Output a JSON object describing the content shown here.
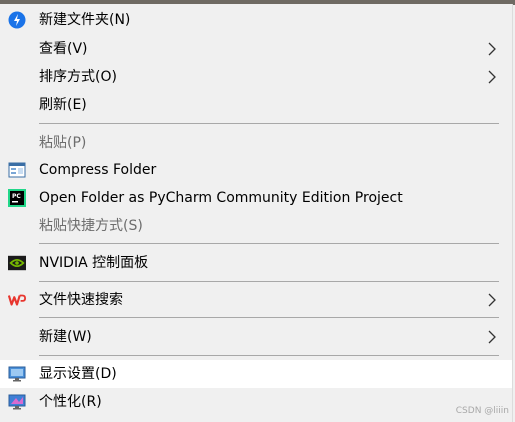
{
  "menu": {
    "new_folder": "新建文件夹(N)",
    "view": "查看(V)",
    "sort_by": "排序方式(O)",
    "refresh": "刷新(E)",
    "paste": "粘贴(P)",
    "compress_folder": "Compress Folder",
    "open_pycharm": "Open Folder as PyCharm Community Edition Project",
    "paste_shortcut": "粘贴快捷方式(S)",
    "nvidia": "NVIDIA 控制面板",
    "file_search": "文件快速搜索",
    "new": "新建(W)",
    "display_settings": "显示设置(D)",
    "personalize": "个性化(R)"
  },
  "icons": {
    "new_folder": "blue-circle-bolt-icon",
    "compress_folder": "compress-window-icon",
    "pycharm": "pycharm-icon",
    "nvidia": "nvidia-icon",
    "file_search": "wps-icon",
    "display_settings": "monitor-icon",
    "personalize": "personalize-icon"
  },
  "colors": {
    "menu_bg": "#f0f0f0",
    "highlight_bg": "#ffffff",
    "disabled_text": "#6d6d6d",
    "separator": "#a8a8a8",
    "accent_blue": "#1a73e8",
    "nvidia_green": "#76b900",
    "wps_red": "#e8362e"
  },
  "watermark": "CSDN @liiin"
}
